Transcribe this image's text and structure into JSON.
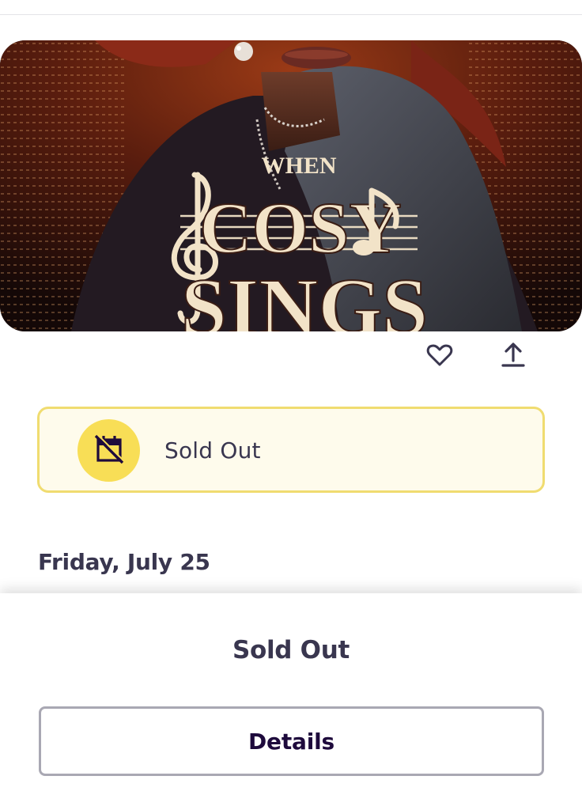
{
  "event": {
    "image_title_top": "WHEN",
    "image_title_mid": "COSY",
    "image_title_bottom": "SINGS",
    "date": "Friday, July 25"
  },
  "actions": {
    "like_icon": "heart-icon",
    "share_icon": "share-upload-icon"
  },
  "banner": {
    "icon": "calendar-slash-icon",
    "text": "Sold Out",
    "accent": "#f8de56",
    "border": "#f0dc70",
    "background": "#fefbec"
  },
  "footer": {
    "status": "Sold Out",
    "details_label": "Details"
  }
}
